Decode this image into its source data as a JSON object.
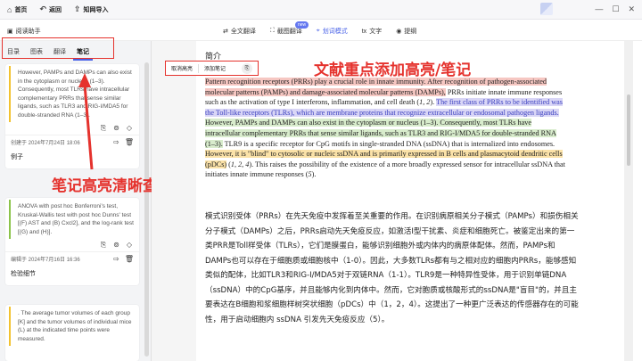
{
  "topbar": {
    "home": "首页",
    "back": "返回",
    "zhiwang_import": "知网导入"
  },
  "toolbar": {
    "panel_title": "阅读助手",
    "modes": [
      {
        "label": "全文翻译",
        "active": false
      },
      {
        "label": "截图翻译",
        "active": false
      },
      {
        "label": "划词模式",
        "active": true
      },
      {
        "label": "文字",
        "active": false
      },
      {
        "label": "提纲",
        "active": false
      }
    ],
    "new_badge": "new"
  },
  "left_tabs": [
    "目录",
    "图表",
    "翻译",
    "笔记"
  ],
  "active_tab": "笔记",
  "notes": [
    {
      "quote": "However, PAMPs and DAMPs can also exist in the cytoplasm or nucleus (1–3). Consequently, most TLRs have intracellular complementary PRRs that sense similar ligands, such as TLR3 and RIG-I/MDA5 for double-stranded RNA (1–3).",
      "color": "yellow",
      "date": "创建于 2024年7月24日 18:06",
      "note": "例子"
    },
    {
      "quote": "ANOVA with post hoc Bonferroni's test, Kruskal-Wallis test with post hoc Dunns' test [(F) AST and (B) Cxcl2], and the log-rank test [(G) and (H)].",
      "color": "green",
      "date": "编辑于 2024年7月16日 16:36",
      "note": "检验细节"
    },
    {
      "quote": ". The average tumor volumes of each group [K] and the tumor volumes of individual mice (L) at the indicated time points were measured.",
      "color": "yellow",
      "date": "",
      "note": ""
    }
  ],
  "popup": {
    "cancel_highlight": "取消高亮",
    "add_note": "添加笔记"
  },
  "annotations": {
    "left": "笔记高亮清晰查看",
    "right": "文献重点添加高亮/笔记"
  },
  "doc": {
    "section_title": "简介",
    "en_segments": [
      {
        "t": "Pattern recognition receptors (PRRs) play a crucial role in innate immunity. After recognition of pathogen-associated molecular patterns (PAMPs) and damage-associated molecular patterns (DAMPs),",
        "c": "red"
      },
      {
        "t": " PRRs initiate innate immune responses such as the activation of type I interferons, inflammation, and cell death (",
        "c": ""
      },
      {
        "t": "1, 2",
        "c": "ref"
      },
      {
        "t": "). ",
        "c": ""
      },
      {
        "t": "The first class of PRRs to be identified was the Toll-like receptors (TLRs), which are membrane proteins that recognize extracellular or endosomal pathogen ligands.",
        "c": "purple"
      },
      {
        "t": " ",
        "c": ""
      },
      {
        "t": "However, PAMPs and DAMPs can also exist in the cytoplasm or nucleus (1–3). Consequently, most TLRs have intracellular complementary PRRs that sense similar ligands, such as TLR3 and RIG-I/MDA5 for double-stranded RNA (1–3).",
        "c": "green"
      },
      {
        "t": " TLR9 is a specific receptor for CpG motifs in single-stranded DNA (ssDNA) that is internalized into endosomes. ",
        "c": ""
      },
      {
        "t": "However, it is \"blind\" to cytosolic or nucleic ssDNA and is primarily expressed in B cells and plasmacytoid dendritic cells (pDCs)",
        "c": "yellow"
      },
      {
        "t": " (",
        "c": ""
      },
      {
        "t": "1, 2, 4",
        "c": "ref"
      },
      {
        "t": "). This raises the possibility of the existence of a more broadly expressed sensor for intracellular ssDNA that initiates innate immune responses (",
        "c": ""
      },
      {
        "t": "5",
        "c": "ref"
      },
      {
        "t": ").",
        "c": ""
      }
    ],
    "cn_text": "模式识别受体（PRRs）在先天免疫中发挥着至关重要的作用。在识别病原相关分子模式（PAMPs）和损伤相关分子模式（DAMPs）之后，PRRs启动先天免疫反应，如激活I型干扰素、炎症和细胞死亡。被鉴定出来的第一类PRR是Toll样受体（TLRs），它们是膜蛋白，能够识别细胞外或内体内的病原体配体。然而，PAMPs和DAMPs也可以存在于细胞质或细胞核中（1-0）。因此，大多数TLRs都有与之相对应的细胞内PRRs，能够感知类似的配体，比如TLR3和RIG-I/MDA5对于双链RNA（1-1）。TLR9是一种特异性受体，用于识别单链DNA（ssDNA）中的CpG基序，并且能够内化到内体中。然而，它对胞质或核酸形式的ssDNA是\"盲目\"的，并且主要表达在B细胞和浆细胞样树突状细胞（pDCs）中（1，2，4）。这提出了一种更广泛表达的传感器存在的可能性，用于启动细胞内 ssDNA 引发先天免疫反应（5）。"
  }
}
